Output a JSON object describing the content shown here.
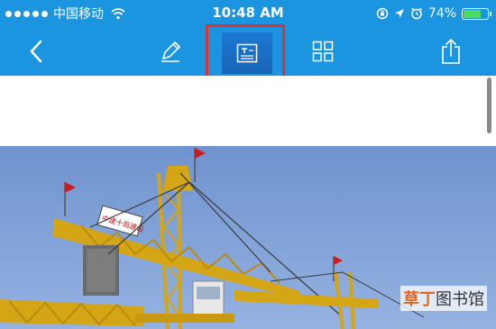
{
  "status_bar": {
    "carrier": "中国移动",
    "time": "10:48 AM",
    "battery_percent": "74%",
    "battery_level": 0.74,
    "icons": [
      "signal-dots-icon",
      "wifi-icon",
      "lock-rotation-icon",
      "location-arrow-icon",
      "alarm-icon",
      "battery-icon"
    ]
  },
  "toolbar": {
    "buttons": [
      "back-chevron-icon",
      "edit-pencil-icon",
      "text-mode-icon",
      "grid-icon",
      "share-icon"
    ],
    "active": "text-mode",
    "highlight_color": "#e03131",
    "bar_color": "#1b95e0"
  },
  "crane_sign": "中建十局建设",
  "watermark": {
    "part1": "草丁",
    "part2": "图书馆"
  }
}
